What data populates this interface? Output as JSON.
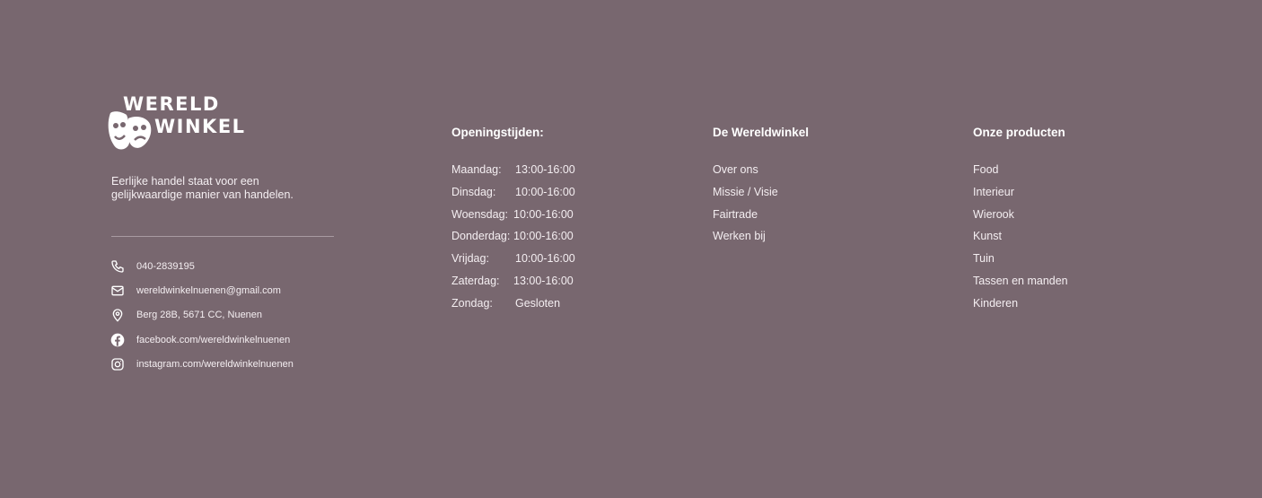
{
  "brand": {
    "logo_line1": "WERELD",
    "logo_line2": "WINKEL",
    "tagline": "Eerlijke handel staat voor een gelijkwaardige manier van handelen."
  },
  "contact": [
    {
      "icon": "phone-icon",
      "text": "040-2839195"
    },
    {
      "icon": "mail-icon",
      "text": "wereldwinkelnuenen@gmail.com"
    },
    {
      "icon": "location-icon",
      "text": "Berg 28B, 5671 CC, Nuenen"
    },
    {
      "icon": "facebook-icon",
      "text": "facebook.com/wereldwinkelnuenen"
    },
    {
      "icon": "instagram-icon",
      "text": "instagram.com/wereldwinkelnuenen"
    }
  ],
  "hours": {
    "title": "Openingstijden:",
    "rows": [
      {
        "day": "Maandag:",
        "time": "13:00-16:00"
      },
      {
        "day": "Dinsdag:",
        "time": "10:00-16:00"
      },
      {
        "day": "Woensdag:",
        "time": "10:00-16:00"
      },
      {
        "day": "Donderdag:",
        "time": "10:00-16:00"
      },
      {
        "day": "Vrijdag:",
        "time": "10:00-16:00"
      },
      {
        "day": "Zaterdag:",
        "time": "13:00-16:00"
      },
      {
        "day": "Zondag:",
        "time": "Gesloten"
      }
    ]
  },
  "about": {
    "title": "De Wereldwinkel",
    "links": [
      "Over ons",
      "Missie / Visie",
      "Fairtrade",
      "Werken bij"
    ]
  },
  "products": {
    "title": "Onze producten",
    "links": [
      "Food",
      "Interieur",
      "Wierook",
      "Kunst",
      "Tuin",
      "Tassen en manden",
      "Kinderen"
    ]
  },
  "colors": {
    "background": "#78676f",
    "text": "#ffffff",
    "divider": "#a89aa1"
  }
}
